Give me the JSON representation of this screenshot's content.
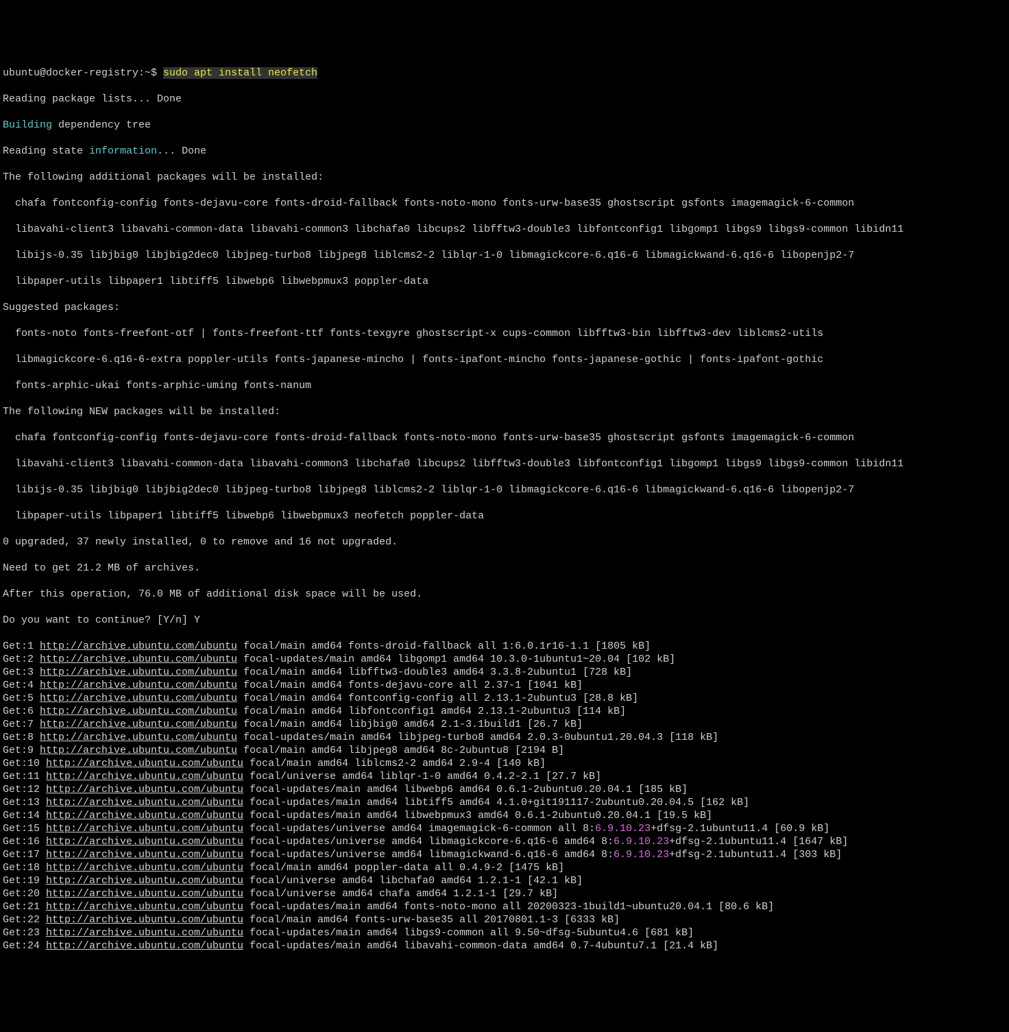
{
  "prompt": {
    "user_host": "ubuntu@docker-registry:~$ ",
    "command": "sudo apt install neofetch"
  },
  "lines": {
    "reading_pkg": "Reading package lists... Done",
    "building": "Building",
    "building_rest": " dependency tree",
    "reading_state_pre": "Reading state ",
    "reading_state_info": "information",
    "reading_state_post": "... Done",
    "additional_header": "The following additional packages will be installed:",
    "additional_1": "  chafa fontconfig-config fonts-dejavu-core fonts-droid-fallback fonts-noto-mono fonts-urw-base35 ghostscript gsfonts imagemagick-6-common",
    "additional_2": "  libavahi-client3 libavahi-common-data libavahi-common3 libchafa0 libcups2 libfftw3-double3 libfontconfig1 libgomp1 libgs9 libgs9-common libidn11",
    "additional_3": "  libijs-0.35 libjbig0 libjbig2dec0 libjpeg-turbo8 libjpeg8 liblcms2-2 liblqr-1-0 libmagickcore-6.q16-6 libmagickwand-6.q16-6 libopenjp2-7",
    "additional_4": "  libpaper-utils libpaper1 libtiff5 libwebp6 libwebpmux3 poppler-data",
    "suggested_header": "Suggested packages:",
    "suggested_1": "  fonts-noto fonts-freefont-otf | fonts-freefont-ttf fonts-texgyre ghostscript-x cups-common libfftw3-bin libfftw3-dev liblcms2-utils",
    "suggested_2": "  libmagickcore-6.q16-6-extra poppler-utils fonts-japanese-mincho | fonts-ipafont-mincho fonts-japanese-gothic | fonts-ipafont-gothic",
    "suggested_3": "  fonts-arphic-ukai fonts-arphic-uming fonts-nanum",
    "new_header": "The following NEW packages will be installed:",
    "new_1": "  chafa fontconfig-config fonts-dejavu-core fonts-droid-fallback fonts-noto-mono fonts-urw-base35 ghostscript gsfonts imagemagick-6-common",
    "new_2": "  libavahi-client3 libavahi-common-data libavahi-common3 libchafa0 libcups2 libfftw3-double3 libfontconfig1 libgomp1 libgs9 libgs9-common libidn11",
    "new_3": "  libijs-0.35 libjbig0 libjbig2dec0 libjpeg-turbo8 libjpeg8 liblcms2-2 liblqr-1-0 libmagickcore-6.q16-6 libmagickwand-6.q16-6 libopenjp2-7",
    "new_4": "  libpaper-utils libpaper1 libtiff5 libwebp6 libwebpmux3 neofetch poppler-data",
    "upgrade_summary": "0 upgraded, 37 newly installed, 0 to remove and 16 not upgraded.",
    "need_get": "Need to get 21.2 MB of archives.",
    "after_op": "After this operation, 76.0 MB of additional disk space will be used.",
    "continue": "Do you want to continue? [Y/n] Y"
  },
  "gets": [
    {
      "n": "Get:1 ",
      "url": "http://archive.ubuntu.com/ubuntu",
      "rest": " focal/main amd64 fonts-droid-fallback all 1:6.0.1r16-1.1 [1805 kB]"
    },
    {
      "n": "Get:2 ",
      "url": "http://archive.ubuntu.com/ubuntu",
      "rest": " focal-updates/main amd64 libgomp1 amd64 10.3.0-1ubuntu1~20.04 [102 kB]"
    },
    {
      "n": "Get:3 ",
      "url": "http://archive.ubuntu.com/ubuntu",
      "rest": " focal/main amd64 libfftw3-double3 amd64 3.3.8-2ubuntu1 [728 kB]"
    },
    {
      "n": "Get:4 ",
      "url": "http://archive.ubuntu.com/ubuntu",
      "rest": " focal/main amd64 fonts-dejavu-core all 2.37-1 [1041 kB]"
    },
    {
      "n": "Get:5 ",
      "url": "http://archive.ubuntu.com/ubuntu",
      "rest": " focal/main amd64 fontconfig-config all 2.13.1-2ubuntu3 [28.8 kB]"
    },
    {
      "n": "Get:6 ",
      "url": "http://archive.ubuntu.com/ubuntu",
      "rest": " focal/main amd64 libfontconfig1 amd64 2.13.1-2ubuntu3 [114 kB]"
    },
    {
      "n": "Get:7 ",
      "url": "http://archive.ubuntu.com/ubuntu",
      "rest": " focal/main amd64 libjbig0 amd64 2.1-3.1build1 [26.7 kB]"
    },
    {
      "n": "Get:8 ",
      "url": "http://archive.ubuntu.com/ubuntu",
      "rest": " focal-updates/main amd64 libjpeg-turbo8 amd64 2.0.3-0ubuntu1.20.04.3 [118 kB]"
    },
    {
      "n": "Get:9 ",
      "url": "http://archive.ubuntu.com/ubuntu",
      "rest": " focal/main amd64 libjpeg8 amd64 8c-2ubuntu8 [2194 B]"
    },
    {
      "n": "Get:10 ",
      "url": "http://archive.ubuntu.com/ubuntu",
      "rest": " focal/main amd64 liblcms2-2 amd64 2.9-4 [140 kB]"
    },
    {
      "n": "Get:11 ",
      "url": "http://archive.ubuntu.com/ubuntu",
      "rest": " focal/universe amd64 liblqr-1-0 amd64 0.4.2-2.1 [27.7 kB]"
    },
    {
      "n": "Get:12 ",
      "url": "http://archive.ubuntu.com/ubuntu",
      "rest": " focal-updates/main amd64 libwebp6 amd64 0.6.1-2ubuntu0.20.04.1 [185 kB]"
    },
    {
      "n": "Get:13 ",
      "url": "http://archive.ubuntu.com/ubuntu",
      "rest": " focal-updates/main amd64 libtiff5 amd64 4.1.0+git191117-2ubuntu0.20.04.5 [162 kB]"
    },
    {
      "n": "Get:14 ",
      "url": "http://archive.ubuntu.com/ubuntu",
      "rest": " focal-updates/main amd64 libwebpmux3 amd64 0.6.1-2ubuntu0.20.04.1 [19.5 kB]"
    },
    {
      "n": "Get:15 ",
      "url": "http://archive.ubuntu.com/ubuntu",
      "rest_pre": " focal-updates/universe amd64 imagemagick-6-common all 8:",
      "mag": "6.9.10.23",
      "rest_post": "+dfsg-2.1ubuntu11.4 [60.9 kB]"
    },
    {
      "n": "Get:16 ",
      "url": "http://archive.ubuntu.com/ubuntu",
      "rest_pre": " focal-updates/universe amd64 libmagickcore-6.q16-6 amd64 8:",
      "mag": "6.9.10.23",
      "rest_post": "+dfsg-2.1ubuntu11.4 [1647 kB]"
    },
    {
      "n": "Get:17 ",
      "url": "http://archive.ubuntu.com/ubuntu",
      "rest_pre": " focal-updates/universe amd64 libmagickwand-6.q16-6 amd64 8:",
      "mag": "6.9.10.23",
      "rest_post": "+dfsg-2.1ubuntu11.4 [303 kB]"
    },
    {
      "n": "Get:18 ",
      "url": "http://archive.ubuntu.com/ubuntu",
      "rest": " focal/main amd64 poppler-data all 0.4.9-2 [1475 kB]"
    },
    {
      "n": "Get:19 ",
      "url": "http://archive.ubuntu.com/ubuntu",
      "rest": " focal/universe amd64 libchafa0 amd64 1.2.1-1 [42.1 kB]"
    },
    {
      "n": "Get:20 ",
      "url": "http://archive.ubuntu.com/ubuntu",
      "rest": " focal/universe amd64 chafa amd64 1.2.1-1 [29.7 kB]"
    },
    {
      "n": "Get:21 ",
      "url": "http://archive.ubuntu.com/ubuntu",
      "rest": " focal-updates/main amd64 fonts-noto-mono all 20200323-1build1~ubuntu20.04.1 [80.6 kB]"
    },
    {
      "n": "Get:22 ",
      "url": "http://archive.ubuntu.com/ubuntu",
      "rest": " focal/main amd64 fonts-urw-base35 all 20170801.1-3 [6333 kB]"
    },
    {
      "n": "Get:23 ",
      "url": "http://archive.ubuntu.com/ubuntu",
      "rest": " focal-updates/main amd64 libgs9-common all 9.50~dfsg-5ubuntu4.6 [681 kB]"
    },
    {
      "n": "Get:24 ",
      "url": "http://archive.ubuntu.com/ubuntu",
      "rest": " focal-updates/main amd64 libavahi-common-data amd64 0.7-4ubuntu7.1 [21.4 kB]"
    }
  ]
}
